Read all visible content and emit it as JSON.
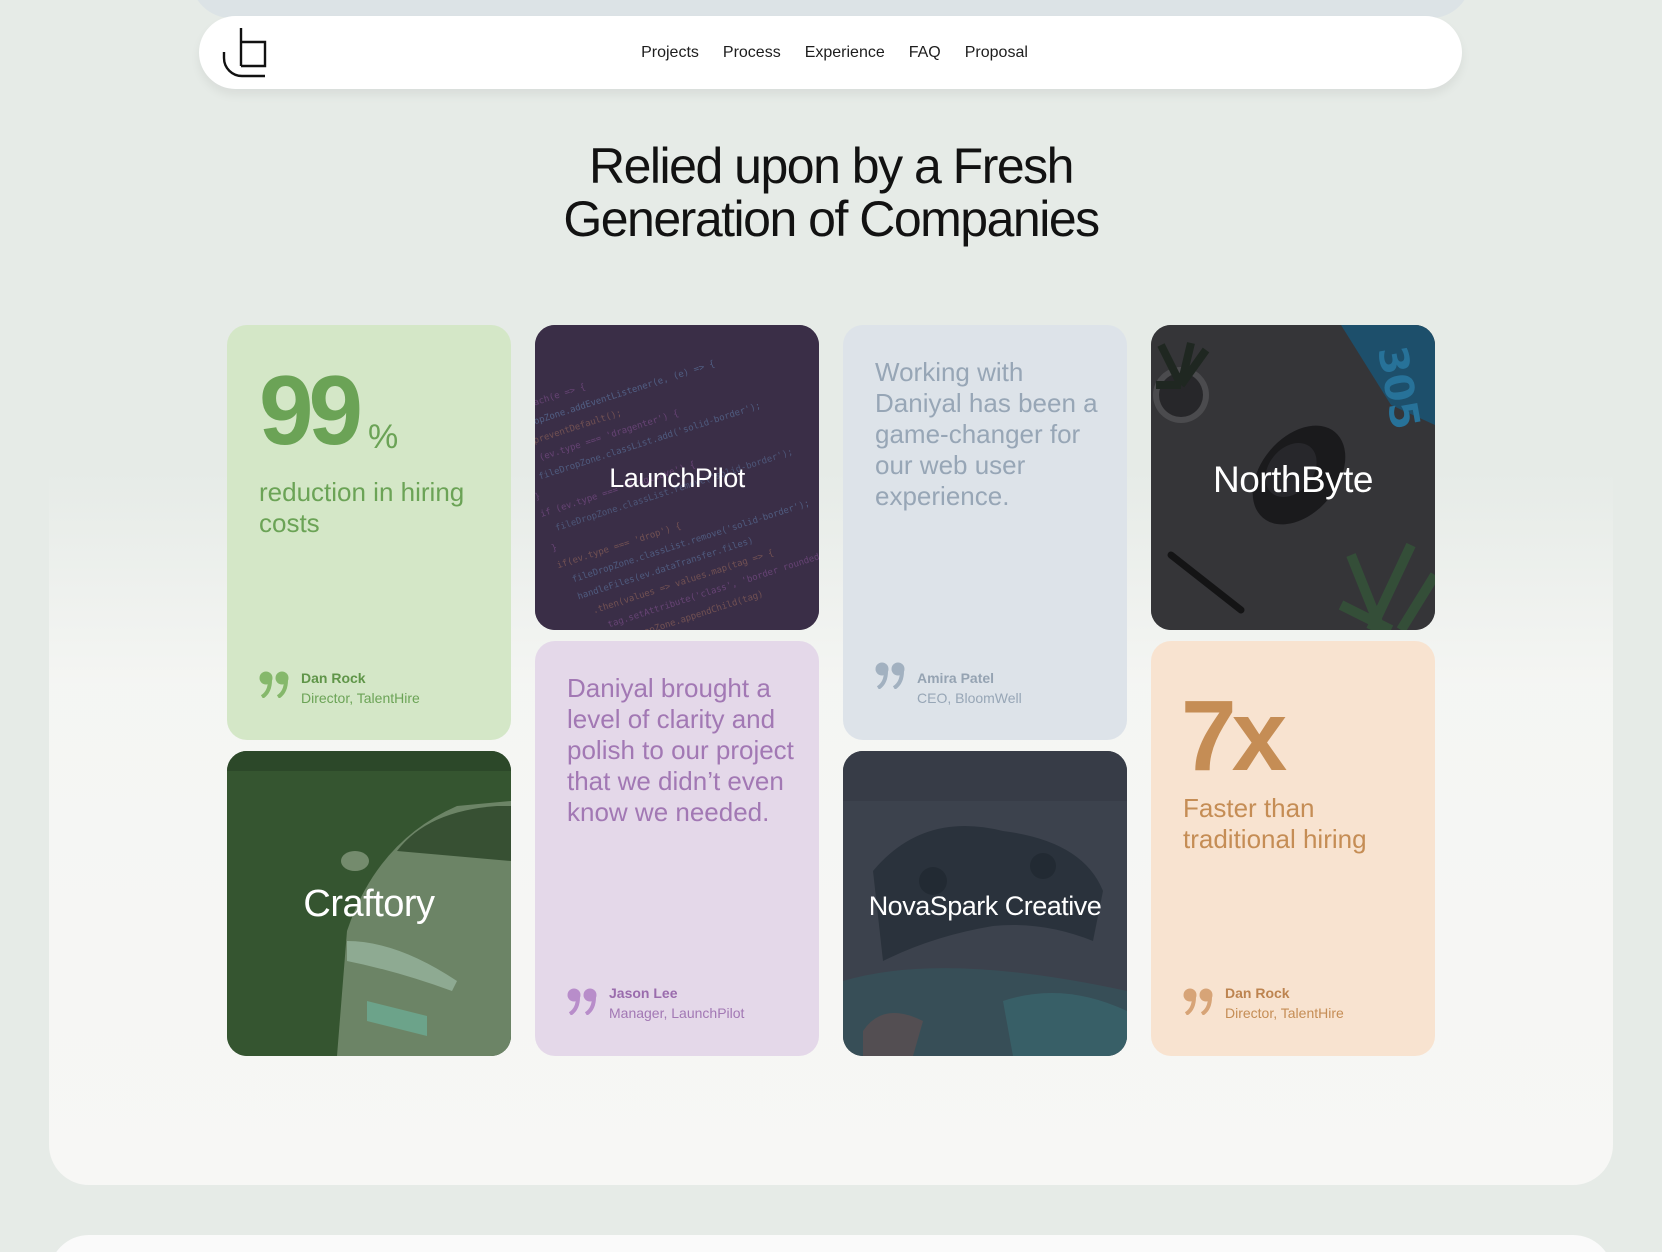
{
  "nav": {
    "logo_alt": "logo",
    "links": [
      "Projects",
      "Process",
      "Experience",
      "FAQ",
      "Proposal"
    ]
  },
  "hero": {
    "title_line1": "Relied upon by a Fresh",
    "title_line2": "Generation of Companies"
  },
  "cards": {
    "stat1": {
      "value": "99",
      "unit": "%",
      "text": "reduction in hiring costs",
      "author": "Dan Rock",
      "role": "Director, TalentHire",
      "color": "#6ba356"
    },
    "launchpilot": {
      "label": "LaunchPilot"
    },
    "quote_amira": {
      "text": "Working with Daniyal has been a game-changer for our web user experience.",
      "author": "Amira Patel",
      "role": "CEO, BloomWell",
      "color": "#97a6b6"
    },
    "northbyte": {
      "label": "NorthByte"
    },
    "craftory": {
      "label": "Craftory"
    },
    "quote_jason": {
      "text": "Daniyal brought a level of clarity and polish to our project that we didn’t even know we needed.",
      "author": "Jason Lee",
      "role": "Manager, LaunchPilot",
      "color": "#a278b4"
    },
    "novaspark": {
      "label": "NovaSpark Creative"
    },
    "stat2": {
      "value": "7x",
      "text": "Faster than traditional hiring",
      "author": "Dan Rock",
      "role": "Director, TalentHire",
      "color": "#c58d55"
    }
  }
}
